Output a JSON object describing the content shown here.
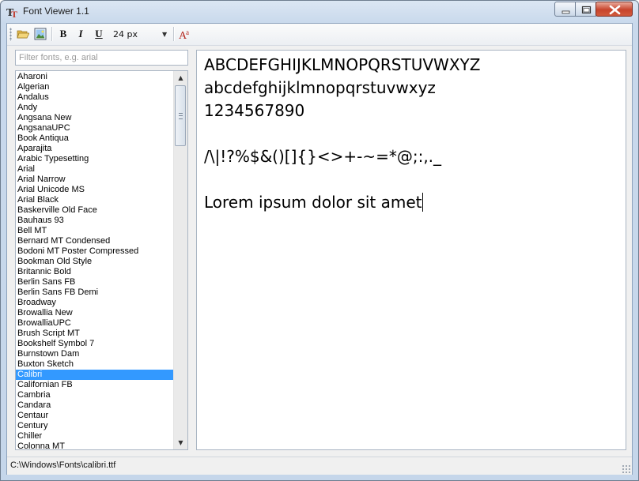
{
  "window": {
    "title": "Font Viewer 1.1"
  },
  "toolbar": {
    "bold_label": "B",
    "italic_label": "I",
    "underline_label": "U",
    "font_size": "24 px"
  },
  "filter": {
    "placeholder": "Filter fonts, e.g. arial",
    "value": ""
  },
  "font_list": {
    "selected": "Calibri",
    "items": [
      "Aharoni",
      "Algerian",
      "Andalus",
      "Andy",
      "Angsana New",
      "AngsanaUPC",
      "Book Antiqua",
      "Aparajita",
      "Arabic Typesetting",
      "Arial",
      "Arial Narrow",
      "Arial Unicode MS",
      "Arial Black",
      "Baskerville Old Face",
      "Bauhaus 93",
      "Bell MT",
      "Bernard MT Condensed",
      "Bodoni MT Poster Compressed",
      "Bookman Old Style",
      "Britannic Bold",
      "Berlin Sans FB",
      "Berlin Sans FB Demi",
      "Broadway",
      "Browallia New",
      "BrowalliaUPC",
      "Brush Script MT",
      "Bookshelf Symbol 7",
      "Burnstown Dam",
      "Buxton Sketch",
      "Calibri",
      "Californian FB",
      "Cambria",
      "Candara",
      "Centaur",
      "Century",
      "Chiller",
      "Colonna MT"
    ]
  },
  "preview": {
    "uppercase": "ABCDEFGHIJKLMNOPQRSTUVWXYZ",
    "lowercase": "abcdefghijklmnopqrstuvwxyz",
    "digits": "1234567890",
    "symbols": "/\\|!?%$&()[]{}<>+-~=*@;:,._",
    "sample": "Lorem ipsum dolor sit amet"
  },
  "statusbar": {
    "path": "C:\\Windows\\Fonts\\calibri.ttf"
  }
}
